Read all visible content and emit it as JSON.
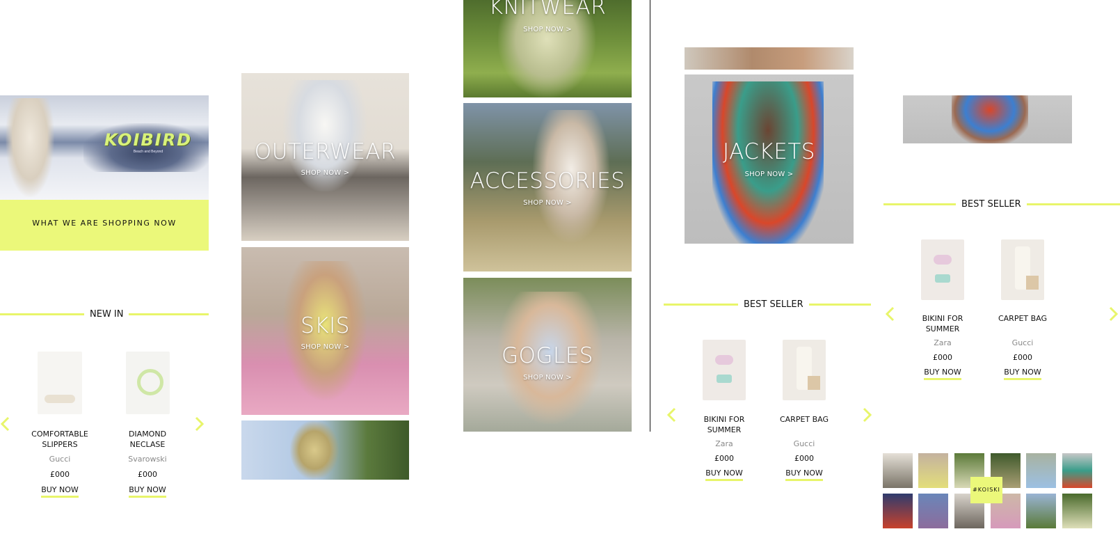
{
  "colors": {
    "accent": "#e8f56a",
    "text": "#111111",
    "muted": "#888888"
  },
  "hero": {
    "logo_text": "KOIBIRD",
    "logo_tagline": "Beach and Beyond",
    "banner_label": "WHAT WE ARE SHOPPING NOW"
  },
  "new_in": {
    "title": "NEW IN",
    "products": [
      {
        "name": "COMFORTABLE SLIPPERS",
        "brand": "Gucci",
        "price": "£000",
        "buy": "BUY NOW"
      },
      {
        "name": "DIAMOND NECLASE",
        "brand": "Svarowski",
        "price": "£000",
        "buy": "BUY NOW"
      }
    ]
  },
  "categories": {
    "shop_now": "SHOP NOW >",
    "outerwear": "OUTERWEAR",
    "skis": "SKIS",
    "knitwear": "KNITWEAR",
    "accessories": "ACCESSORIES",
    "gogles": "GOGLES",
    "jackets": "JACKETS"
  },
  "best_seller_mid": {
    "title": "BEST SELLER",
    "products": [
      {
        "name": "BIKINI FOR SUMMER",
        "brand": "Zara",
        "price": "£000",
        "buy": "BUY NOW"
      },
      {
        "name": "CARPET BAG",
        "brand": "Gucci",
        "price": "£000",
        "buy": "BUY NOW"
      }
    ]
  },
  "best_seller_right": {
    "title": "BEST SELLER",
    "products": [
      {
        "name": "BIKINI FOR SUMMER",
        "brand": "Zara",
        "price": "£000",
        "buy": "BUY NOW"
      },
      {
        "name": "CARPET BAG",
        "brand": "Gucci",
        "price": "£000",
        "buy": "BUY NOW"
      }
    ]
  },
  "instagram": {
    "tag": "#KOISKI"
  },
  "icons": [
    "chevron-left-icon",
    "chevron-right-icon"
  ]
}
